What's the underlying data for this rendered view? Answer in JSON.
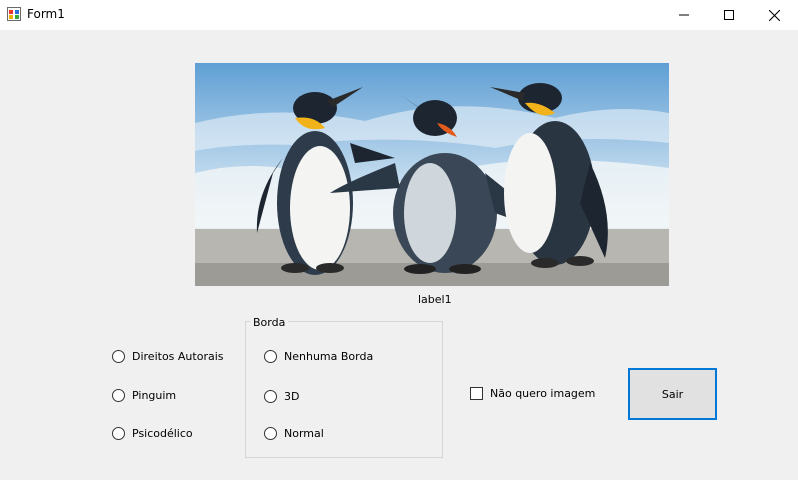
{
  "window": {
    "title": "Form1",
    "icons": [
      "app-icon",
      "minimize-icon",
      "maximize-icon",
      "close-icon"
    ]
  },
  "picture": {
    "description_icon": "penguins-image",
    "sky_color": "#9cc4e4",
    "ground_color": "#b8b6b0"
  },
  "label1": "label1",
  "left_radios": [
    "Direitos Autorais",
    "Pinguim",
    "Psicodélico"
  ],
  "group": {
    "title": "Borda",
    "radios": [
      "Nenhuma Borda",
      "3D",
      "Normal"
    ]
  },
  "checkbox": {
    "label": "Não quero imagem",
    "checked": false
  },
  "exit_button": {
    "label": "Sair"
  },
  "colors": {
    "accent": "#0078d7",
    "background": "#f0f0f0"
  }
}
